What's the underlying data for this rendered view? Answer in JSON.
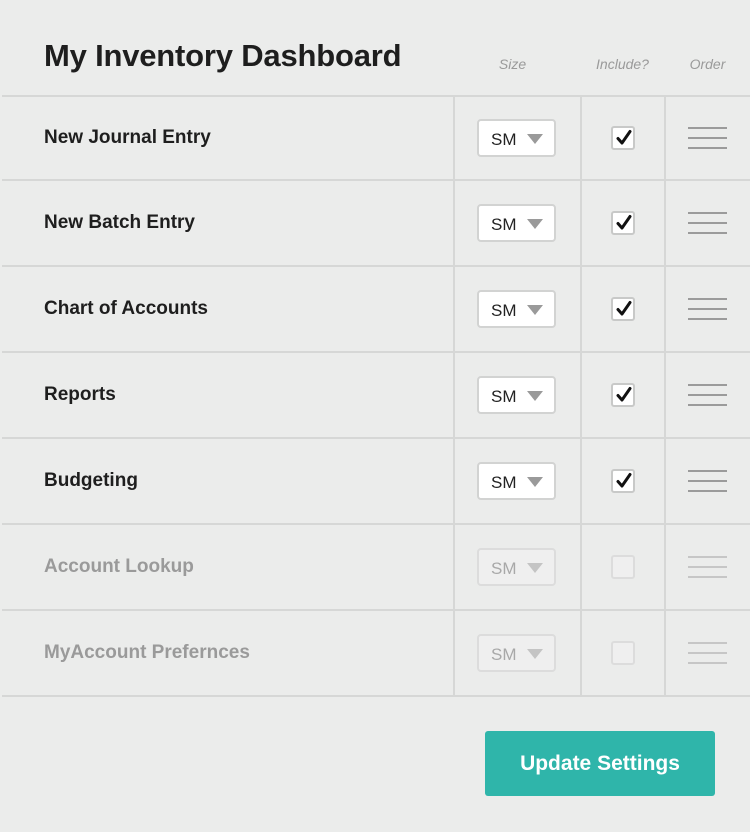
{
  "header": {
    "title": "My Inventory Dashboard",
    "col_size": "Size",
    "col_include": "Include?",
    "col_order": "Order"
  },
  "rows": [
    {
      "label": "New Journal Entry",
      "size": "SM",
      "included": true,
      "enabled": true
    },
    {
      "label": "New Batch Entry",
      "size": "SM",
      "included": true,
      "enabled": true
    },
    {
      "label": "Chart of Accounts",
      "size": "SM",
      "included": true,
      "enabled": true
    },
    {
      "label": "Reports",
      "size": "SM",
      "included": true,
      "enabled": true
    },
    {
      "label": "Budgeting",
      "size": "SM",
      "included": true,
      "enabled": true
    },
    {
      "label": "Account Lookup",
      "size": "SM",
      "included": false,
      "enabled": false
    },
    {
      "label": "MyAccount Prefernces",
      "size": "SM",
      "included": false,
      "enabled": false
    }
  ],
  "footer": {
    "update_label": "Update Settings"
  },
  "colors": {
    "accent": "#2fb5aa",
    "background": "#ebeceb",
    "divider": "#d6d7d6",
    "disabled_text": "#9a9a9a"
  },
  "icons": {
    "dropdown": "chevron-down-icon",
    "check": "checkmark-icon",
    "drag": "drag-handle-icon"
  }
}
